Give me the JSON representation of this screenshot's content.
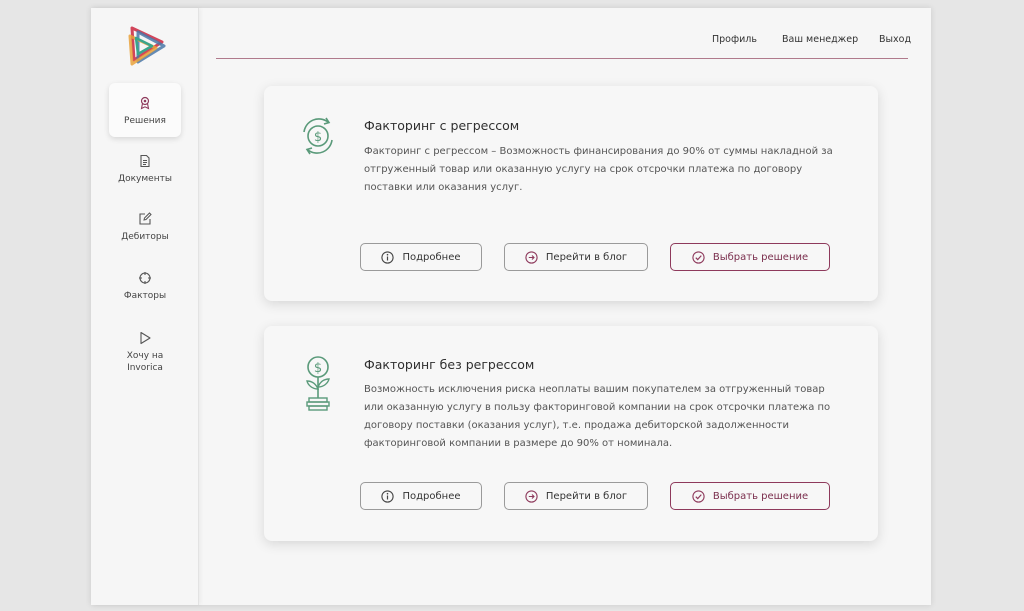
{
  "nav": {
    "items": [
      {
        "label": "Решения",
        "icon": "award-icon"
      },
      {
        "label": "Документы",
        "icon": "document-icon"
      },
      {
        "label": "Дебиторы",
        "icon": "edit-icon"
      },
      {
        "label": "Факторы",
        "icon": "target-icon"
      },
      {
        "label": "Хочу на Invorica",
        "icon": "play-icon"
      }
    ]
  },
  "header": {
    "profile": "Профиль",
    "manager": "Ваш менеджер",
    "logout": "Выход"
  },
  "cards": [
    {
      "title": "Факторинг с регрессом",
      "description": "Факторинг с регрессом – Возможность финансирования до 90% от суммы накладной за отгруженный товар или оказанную услугу на срок отсрочки платежа по договору поставки или оказания услуг.",
      "icon": "dollar-cycle-icon",
      "buttons": {
        "details": "Подробнее",
        "blog": "Перейти в блог",
        "choose": "Выбрать решение"
      }
    },
    {
      "title": "Факторинг без регрессом",
      "description": "Возможность исключения риска неоплаты вашим покупателем за отгруженный товар или оказанную услугу в пользу факторинговой компании на срок отсрочки платежа по договору поставки (оказания услуг), т.е. продажа дебиторской задолженности факторинговой компании в размере до 90% от номинала.",
      "icon": "money-plant-icon",
      "buttons": {
        "details": "Подробнее",
        "blog": "Перейти в блог",
        "choose": "Выбрать решение"
      }
    }
  ],
  "colors": {
    "accent": "#8e3a5c",
    "icon_green": "#5a9a7a",
    "divider": "#b07a8c"
  }
}
